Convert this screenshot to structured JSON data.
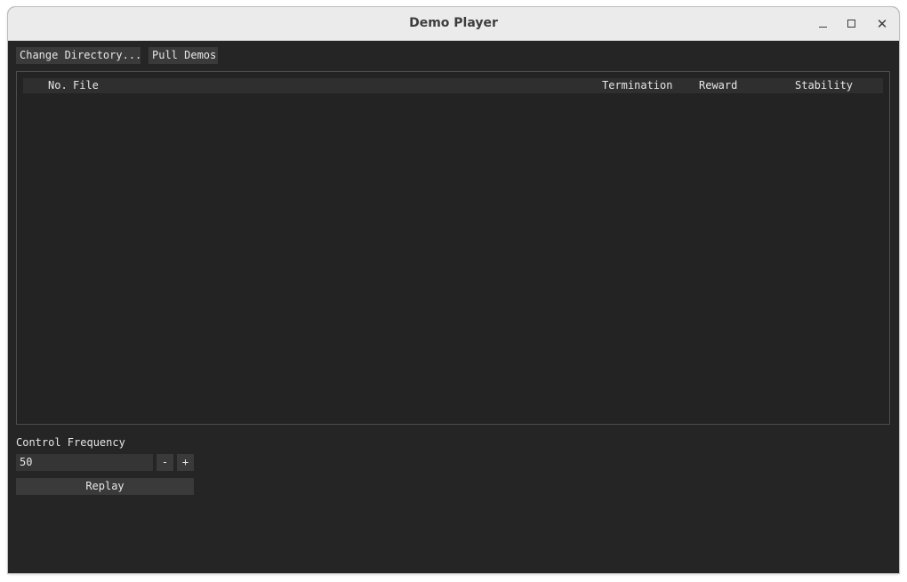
{
  "window": {
    "title": "Demo Player",
    "controls": {
      "minimize_icon": "minimize-icon",
      "maximize_icon": "maximize-icon",
      "close_glyph": "✕"
    }
  },
  "toolbar": {
    "change_directory_label": "Change Directory...",
    "pull_demos_label": "Pull Demos"
  },
  "table": {
    "columns": [
      "No.",
      "File",
      "Termination",
      "Reward",
      "Stability"
    ],
    "rows": []
  },
  "controls": {
    "control_frequency_label": "Control Frequency",
    "control_frequency_value": "50",
    "decrement_label": "-",
    "increment_label": "+",
    "replay_label": "Replay"
  },
  "colors": {
    "background": "#252525",
    "button": "#3a3a3a",
    "text": "#e6e6e6",
    "titlebar": "#ebebeb"
  }
}
